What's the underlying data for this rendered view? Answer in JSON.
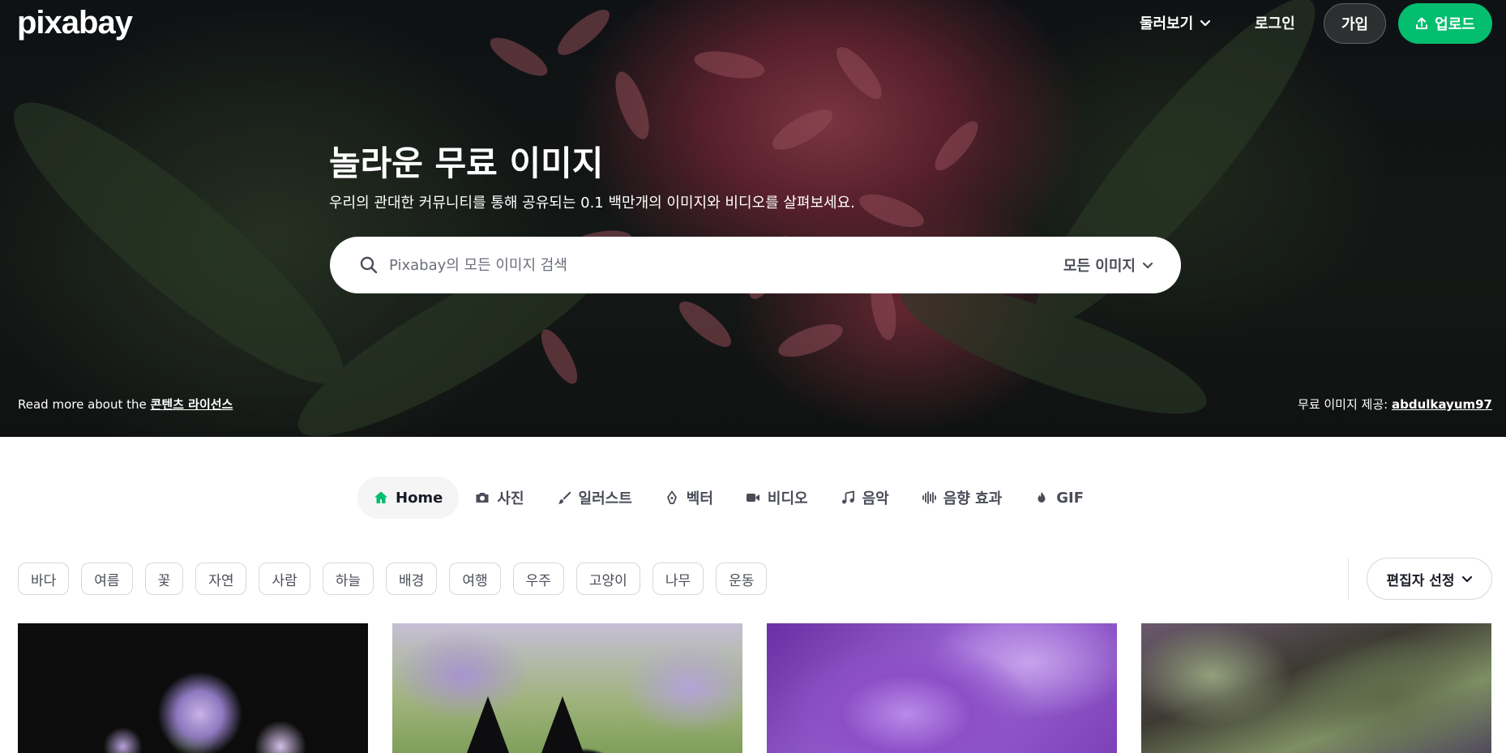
{
  "header": {
    "logo": "pixabay",
    "explore_label": "둘러보기",
    "login_label": "로그인",
    "join_label": "가입",
    "upload_label": "업로드"
  },
  "hero": {
    "title": "놀라운 무료 이미지",
    "subtitle": "우리의 관대한 커뮤니티를 통해 공유되는 0.1 백만개의 이미지와 비디오를 살펴보세요.",
    "license_prefix": "Read more about the ",
    "license_link": "콘텐츠 라이선스",
    "credit_prefix": "무료 이미지 제공: ",
    "credit_user": "abdulkayum97"
  },
  "search": {
    "placeholder": "Pixabay의 모든 이미지 검색",
    "filter_label": "모든 이미지"
  },
  "tabs": [
    {
      "label": "Home",
      "icon": "home-icon",
      "active": true
    },
    {
      "label": "사진",
      "icon": "camera-icon"
    },
    {
      "label": "일러스트",
      "icon": "brush-icon"
    },
    {
      "label": "벡터",
      "icon": "pen-nib-icon"
    },
    {
      "label": "비디오",
      "icon": "video-icon"
    },
    {
      "label": "음악",
      "icon": "music-note-icon"
    },
    {
      "label": "음향 효과",
      "icon": "soundwave-icon"
    },
    {
      "label": "GIF",
      "icon": "flame-icon"
    }
  ],
  "chips": [
    "바다",
    "여름",
    "꽃",
    "자연",
    "사람",
    "하늘",
    "배경",
    "여행",
    "우주",
    "고양이",
    "나무",
    "운동"
  ],
  "sort": {
    "label": "편집자 선정"
  },
  "colors": {
    "accent": "#02be6e",
    "active_tab_icon": "#02be6e"
  }
}
